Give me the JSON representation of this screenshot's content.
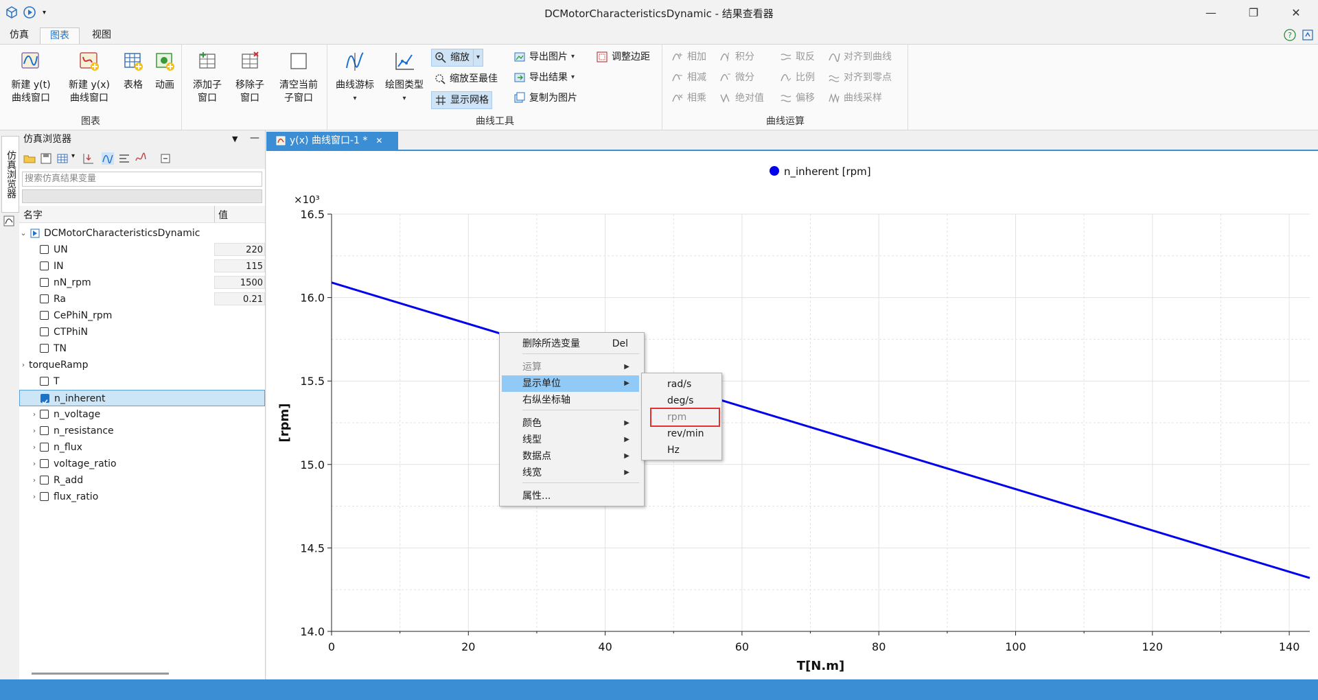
{
  "window": {
    "title": "DCMotorCharacteristicsDynamic - 结果查看器",
    "minimize": "—",
    "restore": "❐",
    "close": "✕"
  },
  "menubar": {
    "tabs": [
      "仿真",
      "图表",
      "视图"
    ],
    "active_tab": "图表",
    "help": "?"
  },
  "ribbon": {
    "chart_group": {
      "label": "图表",
      "buttons": [
        "新建 y(t) 曲线窗口",
        "新建 y(x) 曲线窗口",
        "表格",
        "动画"
      ]
    },
    "window_group": {
      "buttons": [
        "添加子窗口",
        "移除子窗口",
        "清空当前子窗口"
      ]
    },
    "curve_tools": {
      "label": "曲线工具",
      "buttons": [
        "曲线游标",
        "绘图类型"
      ],
      "small": [
        "缩放",
        "缩放至最佳",
        "显示网格",
        "导出图片",
        "导出结果",
        "复制为图片",
        "调整边距"
      ]
    },
    "curve_ops": {
      "label": "曲线运算",
      "items": [
        "相加",
        "积分",
        "取反",
        "对齐到曲线",
        "相减",
        "微分",
        "比例",
        "对齐到零点",
        "相乘",
        "绝对值",
        "偏移",
        "曲线采样"
      ]
    }
  },
  "sidebar": {
    "vertical_tab": "仿真浏览器"
  },
  "browser": {
    "title": "仿真浏览器",
    "search_placeholder": "搜索仿真结果变量",
    "col_name": "名字",
    "col_value": "值",
    "root": "DCMotorCharacteristicsDynamic",
    "rows": [
      {
        "name": "UN",
        "value": "220",
        "checked": false,
        "expandable": false
      },
      {
        "name": "IN",
        "value": "115",
        "checked": false,
        "expandable": false
      },
      {
        "name": "nN_rpm",
        "value": "1500",
        "checked": false,
        "expandable": false
      },
      {
        "name": "Ra",
        "value": "0.21",
        "checked": false,
        "expandable": false
      },
      {
        "name": "CePhiN_rpm",
        "value": "",
        "checked": false,
        "expandable": false
      },
      {
        "name": "CTPhiN",
        "value": "",
        "checked": false,
        "expandable": false
      },
      {
        "name": "TN",
        "value": "",
        "checked": false,
        "expandable": false
      },
      {
        "name": "torqueRamp",
        "value": "",
        "checked": null,
        "expandable": true
      },
      {
        "name": "T",
        "value": "",
        "checked": false,
        "expandable": false
      },
      {
        "name": "n_inherent",
        "value": "",
        "checked": true,
        "expandable": false,
        "selected": true
      },
      {
        "name": "n_voltage",
        "value": "",
        "checked": false,
        "expandable": true
      },
      {
        "name": "n_resistance",
        "value": "",
        "checked": false,
        "expandable": true
      },
      {
        "name": "n_flux",
        "value": "",
        "checked": false,
        "expandable": true
      },
      {
        "name": "voltage_ratio",
        "value": "",
        "checked": false,
        "expandable": true
      },
      {
        "name": "R_add",
        "value": "",
        "checked": false,
        "expandable": true
      },
      {
        "name": "flux_ratio",
        "value": "",
        "checked": false,
        "expandable": true
      }
    ]
  },
  "plot_tab": {
    "label": "y(x) 曲线窗口-1 *",
    "close": "✕"
  },
  "chart_data": {
    "type": "line",
    "title": "",
    "xlabel": "T[N.m]",
    "ylabel": "[rpm]",
    "y_multiplier": "×10³",
    "xlim": [
      0,
      143
    ],
    "ylim": [
      14.0,
      16.5
    ],
    "x_ticks": [
      "0",
      "20",
      "40",
      "60",
      "80",
      "100",
      "120",
      "140"
    ],
    "y_ticks": [
      "14.0",
      "14.5",
      "15.0",
      "15.5",
      "16.0",
      "16.5"
    ],
    "grid": true,
    "legend_position": "top-center",
    "series": [
      {
        "name": "n_inherent [rpm]",
        "color": "#0000ee",
        "x": [
          0,
          143
        ],
        "y": [
          16.09,
          14.32
        ]
      }
    ]
  },
  "context_menu": {
    "items": [
      {
        "label": "删除所选变量",
        "shortcut": "Del",
        "submenu": false,
        "disabled": false
      },
      {
        "label": "运算",
        "submenu": true,
        "disabled": true
      },
      {
        "label": "显示单位",
        "submenu": true,
        "disabled": false,
        "highlighted": true
      },
      {
        "label": "右纵坐标轴",
        "submenu": false,
        "disabled": false
      },
      {
        "label": "颜色",
        "submenu": true,
        "disabled": false
      },
      {
        "label": "线型",
        "submenu": true,
        "disabled": false
      },
      {
        "label": "数据点",
        "submenu": true,
        "disabled": false
      },
      {
        "label": "线宽",
        "submenu": true,
        "disabled": false
      },
      {
        "label": "属性...",
        "submenu": false,
        "disabled": false
      }
    ],
    "units_submenu": [
      "rad/s",
      "deg/s",
      "rpm",
      "rev/min",
      "Hz"
    ],
    "units_current": "rpm"
  }
}
